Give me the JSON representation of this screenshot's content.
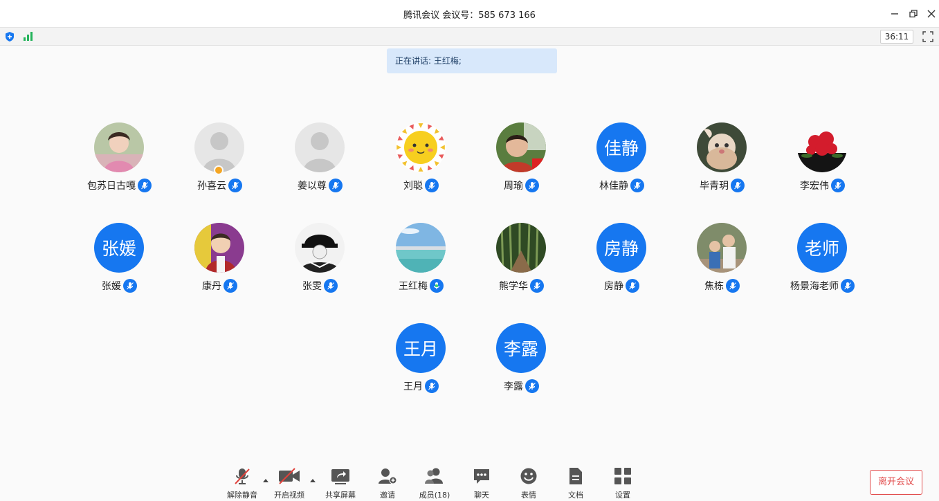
{
  "window": {
    "title": "腾讯会议 会议号：585 673 166"
  },
  "status": {
    "timer": "36:11"
  },
  "speaking_banner": "正在讲话: 王红梅;",
  "participants": [
    {
      "name": "包苏日古嘎",
      "avatar": "photo-child"
    },
    {
      "name": "孙喜云",
      "avatar": "default"
    },
    {
      "name": "姜以尊",
      "avatar": "default"
    },
    {
      "name": "刘聪",
      "avatar": "sun"
    },
    {
      "name": "周瑜",
      "avatar": "photo-boy"
    },
    {
      "name": "林佳静",
      "avatar_text": "佳静"
    },
    {
      "name": "毕青玥",
      "avatar": "photo-doll"
    },
    {
      "name": "李宏伟",
      "avatar": "photo-flower"
    },
    {
      "name": "张媛",
      "avatar_text": "张媛"
    },
    {
      "name": "康丹",
      "avatar": "photo-baby"
    },
    {
      "name": "张雯",
      "avatar": "photo-cap"
    },
    {
      "name": "王红梅",
      "avatar": "photo-lake",
      "speaking": true
    },
    {
      "name": "熊学华",
      "avatar": "photo-bamboo"
    },
    {
      "name": "房静",
      "avatar_text": "房静"
    },
    {
      "name": "焦栋",
      "avatar": "photo-kids"
    },
    {
      "name": "杨景海老师",
      "avatar_text": "老师"
    },
    {
      "name": "王月",
      "avatar_text": "王月"
    },
    {
      "name": "李露",
      "avatar_text": "李露"
    }
  ],
  "toolbar": {
    "unmute": "解除静音",
    "start_video": "开启视频",
    "share_screen": "共享屏幕",
    "invite": "邀请",
    "members": "成员(18)",
    "chat": "聊天",
    "reaction": "表情",
    "docs": "文档",
    "settings": "设置"
  },
  "leave_button": "离开会议",
  "colors": {
    "accent": "#1677f0",
    "leave": "#e24b4b",
    "banner": "#d8e8fb"
  }
}
